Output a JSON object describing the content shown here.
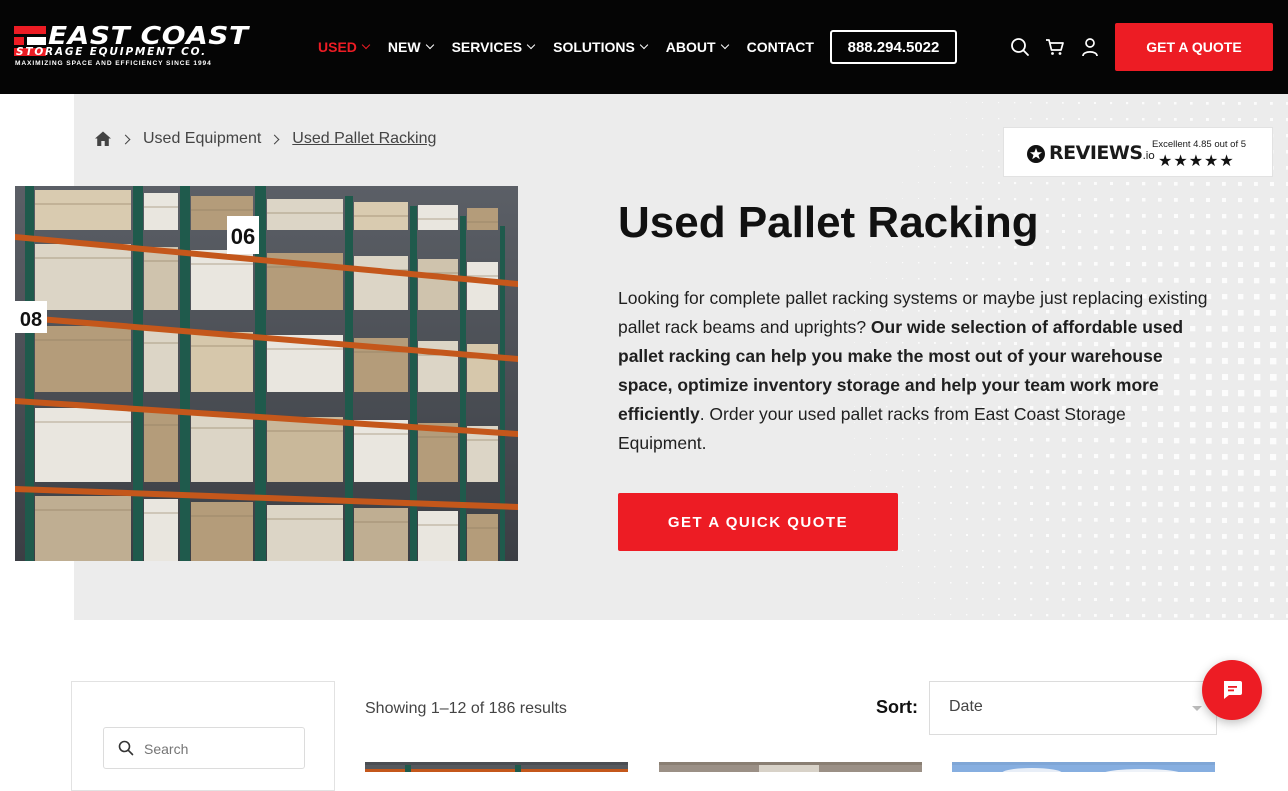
{
  "header": {
    "logo": {
      "line1": "EAST COAST",
      "line2": "STORAGE EQUIPMENT CO.",
      "tagline": "MAXIMIZING SPACE AND EFFICIENCY SINCE 1994"
    },
    "nav": [
      {
        "label": "USED",
        "active": true,
        "has_dropdown": true
      },
      {
        "label": "NEW",
        "active": false,
        "has_dropdown": true
      },
      {
        "label": "SERVICES",
        "active": false,
        "has_dropdown": true
      },
      {
        "label": "SOLUTIONS",
        "active": false,
        "has_dropdown": true
      },
      {
        "label": "ABOUT",
        "active": false,
        "has_dropdown": true
      },
      {
        "label": "CONTACT",
        "active": false,
        "has_dropdown": false
      }
    ],
    "phone": "888.294.5022",
    "icons": [
      "search-icon",
      "cart-icon",
      "account-icon"
    ],
    "quote_button": "GET A QUOTE"
  },
  "breadcrumb": {
    "home_icon": "home-icon",
    "items": [
      "Used Equipment",
      "Used Pallet Racking"
    ]
  },
  "reviews": {
    "brand": "REVIEWS",
    "brand_suffix": ".io",
    "summary": "Excellent 4.85 out of 5",
    "rating": 4.85,
    "stars": "★★★★★"
  },
  "hero": {
    "title": "Used Pallet Racking",
    "desc_part1": "Looking for complete pallet racking systems or maybe just replacing existing pallet rack beams and uprights? ",
    "desc_bold": "Our wide selection of affordable used pallet racking can help you make the most out of your warehouse space, optimize inventory storage and help your team work more efficiently",
    "desc_part2": ". Order your used pallet racks from East Coast Storage Equipment.",
    "cta": "GET A QUICK QUOTE",
    "image_labels": [
      "06",
      "08"
    ]
  },
  "shop": {
    "search_placeholder": "Search",
    "results_text": "Showing 1–12 of 186 results",
    "sort_label": "Sort:",
    "sort_value": "Date"
  },
  "colors": {
    "brand_red": "#ed1c24",
    "header_bg": "#050505",
    "hero_bg": "#ececec"
  }
}
